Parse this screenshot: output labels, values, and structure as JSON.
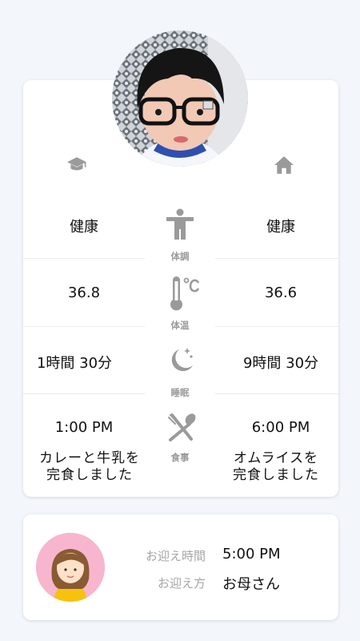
{
  "categories": [
    {
      "label": "体調",
      "icon": "person-standing-icon"
    },
    {
      "label": "体温",
      "icon": "thermometer-celsius-icon"
    },
    {
      "label": "睡眠",
      "icon": "moon-stars-icon"
    },
    {
      "label": "食事",
      "icon": "fork-spoon-icon"
    }
  ],
  "school": {
    "icon": "graduation-cap-icon",
    "condition": "健康",
    "temperature": "36.8",
    "sleep": "1時間 30分",
    "meal_time": "1:00 PM",
    "meal_line1": "カレーと牛乳を",
    "meal_line2": "完食しました"
  },
  "home": {
    "icon": "home-icon",
    "condition": "健康",
    "temperature": "36.6",
    "sleep": "9時間 30分",
    "meal_time": "6:00 PM",
    "meal_line1": "オムライスを",
    "meal_line2": "完食しました"
  },
  "pickup": {
    "time_label": "お迎え時間",
    "time_value": "5:00 PM",
    "person_label": "お迎え方",
    "person_value": "お母さん"
  },
  "colors": {
    "background": "#f3f6fb",
    "card": "#ffffff",
    "icon_gray": "#9a9a9a",
    "avatar_pink": "#f7b6cd"
  }
}
